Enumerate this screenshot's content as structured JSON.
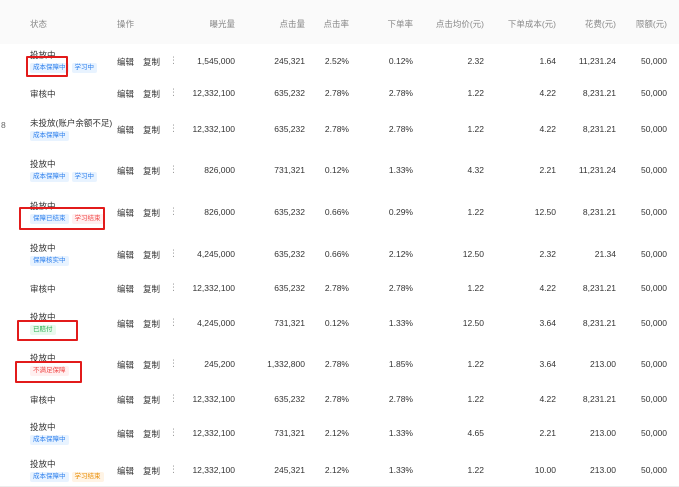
{
  "columns": {
    "status": "状态",
    "actions": "操作",
    "impressions": "曝光量",
    "clicks": "点击量",
    "ctr": "点击率",
    "cvr": "下单率",
    "cpc": "点击均价(元)",
    "cpa": "下单成本(元)",
    "spend": "花费(元)",
    "limit": "限额(元)"
  },
  "actions": {
    "edit": "编辑",
    "copy": "复制",
    "more": "⋮"
  },
  "edge_text": "8",
  "rows": [
    {
      "status": "投放中",
      "tags": [
        {
          "text": "成本保障中",
          "color": "blue"
        },
        {
          "text": "学习中",
          "color": "blue"
        }
      ],
      "impressions": "1,545,000",
      "clicks": "245,321",
      "ctr": "2.52%",
      "cvr": "0.12%",
      "cpc": "2.32",
      "cpa": "1.64",
      "spend": "11,231.24",
      "limit": "50,000"
    },
    {
      "status": "审核中",
      "tags": [],
      "impressions": "12,332,100",
      "clicks": "635,232",
      "ctr": "2.78%",
      "cvr": "2.78%",
      "cpc": "1.22",
      "cpa": "4.22",
      "spend": "8,231.21",
      "limit": "50,000"
    },
    {
      "status": "未投放(账户余额不足)",
      "tags": [
        {
          "text": "成本保障中",
          "color": "blue"
        }
      ],
      "impressions": "12,332,100",
      "clicks": "635,232",
      "ctr": "2.78%",
      "cvr": "2.78%",
      "cpc": "1.22",
      "cpa": "4.22",
      "spend": "8,231.21",
      "limit": "50,000"
    },
    {
      "status": "投放中",
      "tags": [
        {
          "text": "成本保障中",
          "color": "blue"
        },
        {
          "text": "学习中",
          "color": "blue"
        }
      ],
      "impressions": "826,000",
      "clicks": "731,321",
      "ctr": "0.12%",
      "cvr": "1.33%",
      "cpc": "4.32",
      "cpa": "2.21",
      "spend": "11,231.24",
      "limit": "50,000"
    },
    {
      "status": "投放中",
      "tags": [
        {
          "text": "保障已结束",
          "color": "blue"
        },
        {
          "text": "学习结束",
          "color": "red"
        }
      ],
      "impressions": "826,000",
      "clicks": "635,232",
      "ctr": "0.66%",
      "cvr": "0.29%",
      "cpc": "1.22",
      "cpa": "12.50",
      "spend": "8,231.21",
      "limit": "50,000"
    },
    {
      "status": "投放中",
      "tags": [
        {
          "text": "保障核实中",
          "color": "blue"
        }
      ],
      "impressions": "4,245,000",
      "clicks": "635,232",
      "ctr": "0.66%",
      "cvr": "2.12%",
      "cpc": "12.50",
      "cpa": "2.32",
      "spend": "21.34",
      "limit": "50,000"
    },
    {
      "status": "审核中",
      "tags": [],
      "impressions": "12,332,100",
      "clicks": "635,232",
      "ctr": "2.78%",
      "cvr": "2.78%",
      "cpc": "1.22",
      "cpa": "4.22",
      "spend": "8,231.21",
      "limit": "50,000"
    },
    {
      "status": "投放中",
      "tags": [
        {
          "text": "已赔付",
          "color": "green"
        }
      ],
      "impressions": "4,245,000",
      "clicks": "731,321",
      "ctr": "0.12%",
      "cvr": "1.33%",
      "cpc": "12.50",
      "cpa": "3.64",
      "spend": "8,231.21",
      "limit": "50,000"
    },
    {
      "status": "投放中",
      "tags": [
        {
          "text": "不满足保障",
          "color": "red"
        }
      ],
      "impressions": "245,200",
      "clicks": "1,332,800",
      "ctr": "2.78%",
      "cvr": "1.85%",
      "cpc": "1.22",
      "cpa": "3.64",
      "spend": "213.00",
      "limit": "50,000"
    },
    {
      "status": "审核中",
      "tags": [],
      "impressions": "12,332,100",
      "clicks": "635,232",
      "ctr": "2.78%",
      "cvr": "2.78%",
      "cpc": "1.22",
      "cpa": "4.22",
      "spend": "8,231.21",
      "limit": "50,000"
    },
    {
      "status": "投放中",
      "tags": [
        {
          "text": "成本保障中",
          "color": "blue"
        }
      ],
      "impressions": "12,332,100",
      "clicks": "731,321",
      "ctr": "2.12%",
      "cvr": "1.33%",
      "cpc": "4.65",
      "cpa": "2.21",
      "spend": "213.00",
      "limit": "50,000"
    },
    {
      "status": "投放中",
      "tags": [
        {
          "text": "成本保障中",
          "color": "blue"
        },
        {
          "text": "学习结束",
          "color": "orange"
        }
      ],
      "impressions": "12,332,100",
      "clicks": "245,321",
      "ctr": "2.12%",
      "cvr": "1.33%",
      "cpc": "1.22",
      "cpa": "10.00",
      "spend": "213.00",
      "limit": "50,000"
    }
  ],
  "colors": {
    "highlight": "#e21b1b",
    "tag_blue": "#2f80ed",
    "tag_red": "#f04848",
    "tag_green": "#22b04b",
    "tag_orange": "#e88b00"
  }
}
